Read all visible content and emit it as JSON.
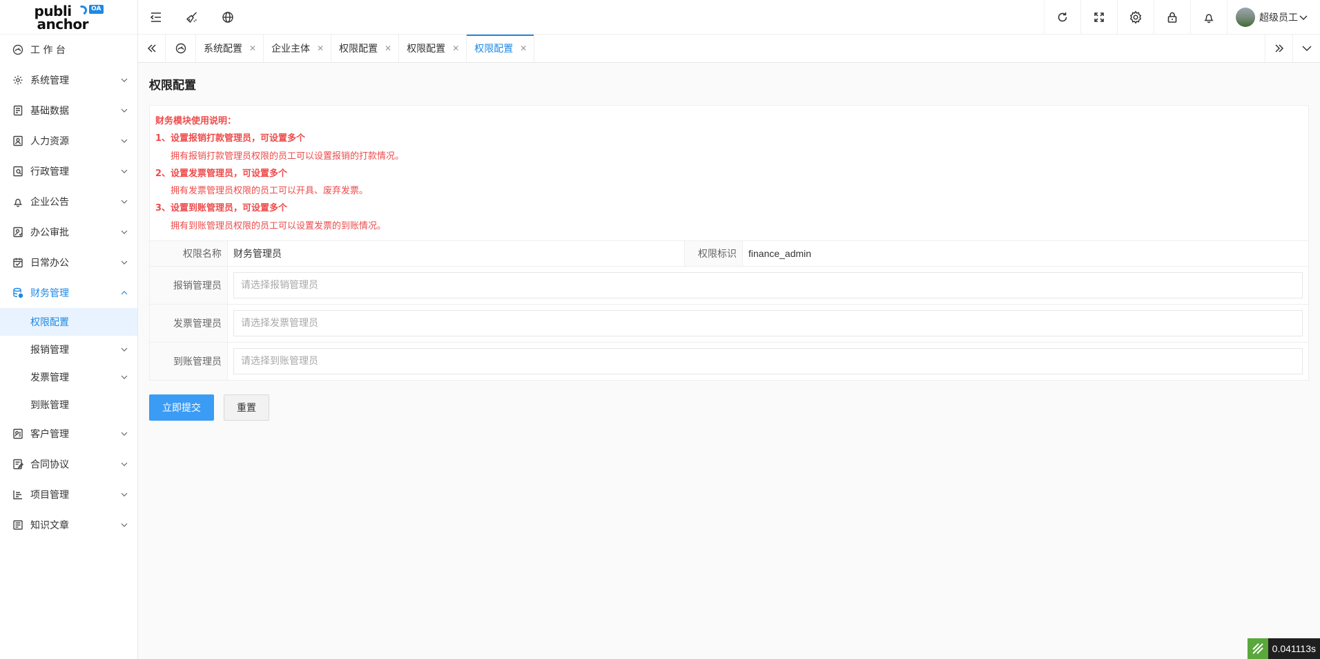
{
  "logo": {
    "line1": "publi",
    "line2": "anchor",
    "badge": "OA"
  },
  "header": {
    "left_icons": [
      "menu-fold-icon",
      "brush-icon",
      "globe-icon"
    ],
    "right_icons": [
      "refresh-icon",
      "fullscreen-icon",
      "settings-gear-icon",
      "lock-icon",
      "bell-icon"
    ],
    "user_name": "超级员工"
  },
  "sidebar": {
    "items": [
      {
        "label": "工 作 台",
        "icon": "dashboard-icon",
        "has_children": false
      },
      {
        "label": "系统管理",
        "icon": "system-gear-icon",
        "has_children": true
      },
      {
        "label": "基础数据",
        "icon": "database-doc-icon",
        "has_children": true
      },
      {
        "label": "人力资源",
        "icon": "person-card-icon",
        "has_children": true
      },
      {
        "label": "行政管理",
        "icon": "admin-stamp-icon",
        "has_children": true
      },
      {
        "label": "企业公告",
        "icon": "bell-icon",
        "has_children": true
      },
      {
        "label": "办公审批",
        "icon": "approval-icon",
        "has_children": true
      },
      {
        "label": "日常办公",
        "icon": "calendar-icon",
        "has_children": true
      },
      {
        "label": "财务管理",
        "icon": "finance-icon",
        "has_children": true,
        "expanded": true,
        "children": [
          {
            "label": "权限配置",
            "selected": true,
            "has_children": false
          },
          {
            "label": "报销管理",
            "has_children": true
          },
          {
            "label": "发票管理",
            "has_children": true
          },
          {
            "label": "到账管理",
            "has_children": false
          }
        ]
      },
      {
        "label": "客户管理",
        "icon": "customer-icon",
        "has_children": true
      },
      {
        "label": "合同协议",
        "icon": "contract-icon",
        "has_children": true
      },
      {
        "label": "项目管理",
        "icon": "project-icon",
        "has_children": true
      },
      {
        "label": "知识文章",
        "icon": "article-icon",
        "has_children": true
      }
    ]
  },
  "tabs": [
    {
      "label": "系统配置",
      "active": false
    },
    {
      "label": "企业主体",
      "active": false
    },
    {
      "label": "权限配置",
      "active": false
    },
    {
      "label": "权限配置",
      "active": false
    },
    {
      "label": "权限配置",
      "active": true
    }
  ],
  "page": {
    "title": "权限配置",
    "notice": {
      "title": "财务模块使用说明：",
      "points": [
        {
          "head": "1、设置报销打款管理员，可设置多个",
          "desc": "拥有报销打款管理员权限的员工可以设置报销的打款情况。"
        },
        {
          "head": "2、设置发票管理员，可设置多个",
          "desc": "拥有发票管理员权限的员工可以开具、废弃发票。"
        },
        {
          "head": "3、设置到账管理员，可设置多个",
          "desc": "拥有到账管理员权限的员工可以设置发票的到账情况。"
        }
      ]
    },
    "form": {
      "name_label": "权限名称",
      "name_value": "财务管理员",
      "key_label": "权限标识",
      "key_value": "finance_admin",
      "fields": [
        {
          "label": "报销管理员",
          "placeholder": "请选择报销管理员",
          "value": ""
        },
        {
          "label": "发票管理员",
          "placeholder": "请选择发票管理员",
          "value": ""
        },
        {
          "label": "到账管理员",
          "placeholder": "请选择到账管理员",
          "value": ""
        }
      ]
    },
    "buttons": {
      "submit": "立即提交",
      "reset": "重置"
    }
  },
  "debug_timer": "0.041113s",
  "colors": {
    "accent": "#1e88e5",
    "primary_button": "#3a9cf5",
    "notice_red": "#ee4b4b",
    "selected_bg": "#e8f3ff"
  }
}
